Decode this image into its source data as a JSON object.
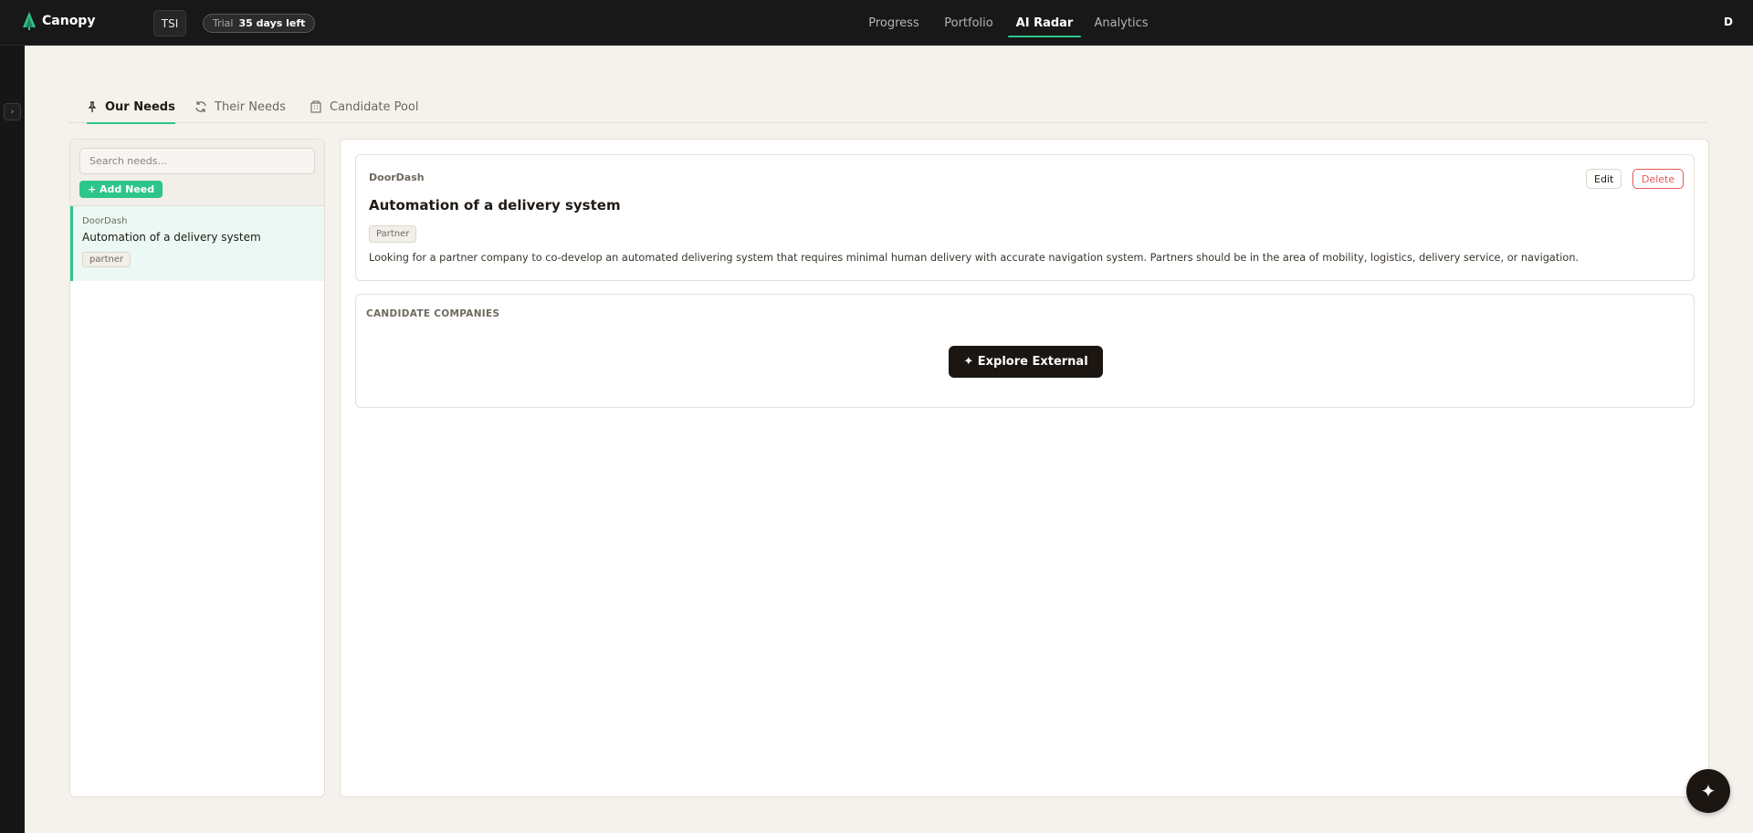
{
  "app": {
    "name": "Canopy",
    "org": "TSI",
    "trial": {
      "label": "Trial",
      "remaining": "35 days left"
    },
    "user_initial": "D"
  },
  "nav": [
    {
      "label": "Progress",
      "active": false
    },
    {
      "label": "Portfolio",
      "active": false
    },
    {
      "label": "AI Radar",
      "active": true
    },
    {
      "label": "Analytics",
      "active": false
    }
  ],
  "tabs": [
    {
      "label": "Our Needs",
      "icon": "pin-icon",
      "active": true
    },
    {
      "label": "Their Needs",
      "icon": "refresh-icon",
      "active": false
    },
    {
      "label": "Candidate Pool",
      "icon": "building-icon",
      "active": false
    }
  ],
  "sidebar": {
    "search_placeholder": "Search needs...",
    "add_label": "+ Add Need",
    "items": [
      {
        "company": "DoorDash",
        "title": "Automation of a delivery system",
        "tag": "partner",
        "selected": true
      }
    ]
  },
  "detail": {
    "company": "DoorDash",
    "title": "Automation of a delivery system",
    "tag": "Partner",
    "description": "Looking for a partner company to co-develop an automated delivering system that requires minimal human delivery with accurate navigation system. Partners should be in the area of mobility, logistics, delivery service, or navigation.",
    "edit_label": "Edit",
    "delete_label": "Delete"
  },
  "candidates": {
    "heading": "CANDIDATE COMPANIES",
    "explore_label": "✦ Explore External"
  },
  "fab": {
    "icon": "sparkle-icon",
    "glyph": "✦"
  },
  "colors": {
    "accent": "#2ec58a",
    "danger": "#e15757",
    "dark": "#1c1612",
    "topbar": "#181818",
    "canvas": "#f5f2ed"
  }
}
